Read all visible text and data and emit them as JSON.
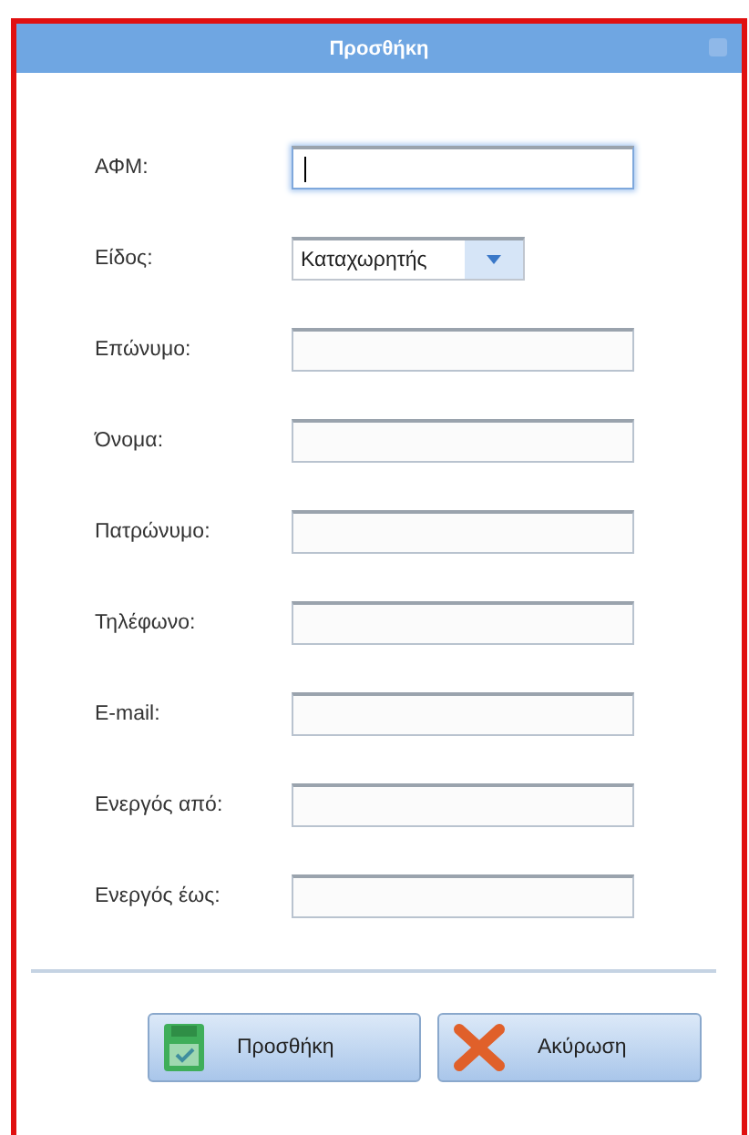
{
  "window": {
    "title": "Προσθήκη"
  },
  "fields": [
    {
      "kind": "text",
      "label": "ΑΦΜ:",
      "focused": true
    },
    {
      "kind": "select",
      "label": "Είδος:",
      "value": "Καταχωρητής",
      "focused": false
    },
    {
      "kind": "text",
      "label": "Επώνυμο:",
      "focused": false
    },
    {
      "kind": "text",
      "label": "Όνομα:",
      "focused": false
    },
    {
      "kind": "text",
      "label": "Πατρώνυμο:",
      "focused": false
    },
    {
      "kind": "text",
      "label": "Τηλέφωνο:",
      "focused": false
    },
    {
      "kind": "text",
      "label": "E-mail:",
      "focused": false
    },
    {
      "kind": "text",
      "label": "Ενεργός από:",
      "focused": false
    },
    {
      "kind": "text",
      "label": "Ενεργός έως:",
      "focused": false
    }
  ],
  "buttons": [
    {
      "kind": "save",
      "label": "Προσθήκη"
    },
    {
      "kind": "cancel",
      "label": "Ακύρωση"
    }
  ]
}
